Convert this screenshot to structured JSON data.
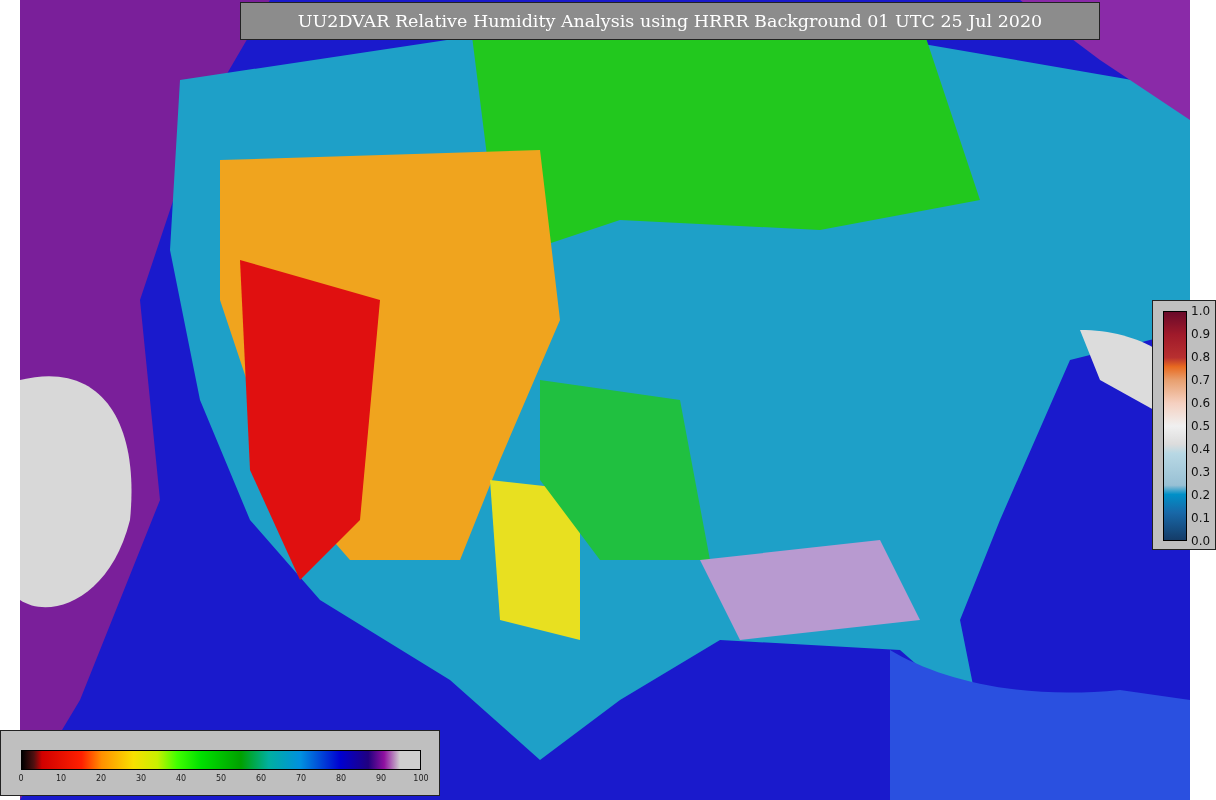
{
  "title": "UU2DVAR Relative Humidity Analysis using HRRR Background 01 UTC 25 Jul 2020",
  "humidity_colorbar": {
    "ticks": [
      "0",
      "10",
      "20",
      "30",
      "40",
      "50",
      "60",
      "70",
      "80",
      "90",
      "100"
    ]
  },
  "station_colorbar": {
    "ticks": [
      "1.0",
      "0.9",
      "0.8",
      "0.7",
      "0.6",
      "0.5",
      "0.4",
      "0.3",
      "0.2",
      "0.1",
      "0.0"
    ]
  }
}
